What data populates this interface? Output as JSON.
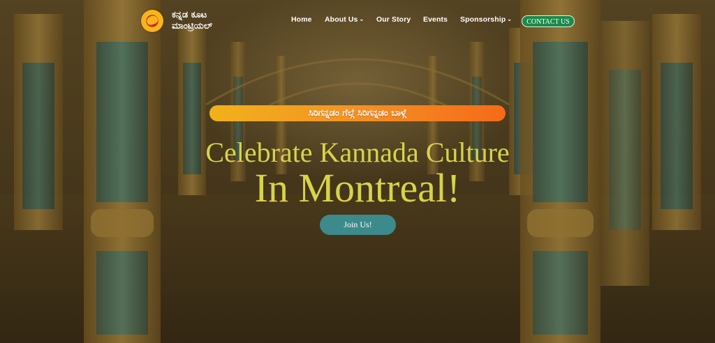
{
  "brand": {
    "name_line1": "ಕನ್ನಡ ಕೂಟ",
    "name_line2": "ಮಾಂಟ್ರಿಯಲ್"
  },
  "nav": {
    "items": [
      {
        "label": "Home"
      },
      {
        "label": "About Us"
      },
      {
        "label": "Our Story"
      },
      {
        "label": "Events"
      },
      {
        "label": "Sponsorship"
      }
    ],
    "contact_label": "CONTACT US"
  },
  "hero": {
    "banner_text": "ಸಿರಿಗನ್ನಡಂ ಗೆಲ್ಗೆ ಸಿರಿಗನ್ನಡಂ ಬಾಳ್ಗೆ",
    "title_line1": "Celebrate Kannada Culture",
    "title_line2": "In Montreal!",
    "cta_label": "Join Us!"
  },
  "icons": {
    "chevron": "chevron-down-icon",
    "logo": "kannada-koota-logo"
  },
  "colors": {
    "headline": "#d7d34b",
    "cta_bg": "#3c8a8c",
    "contact_bg": "#1d8a4a",
    "banner_start": "#f1b21a",
    "banner_end": "#f56a18"
  }
}
